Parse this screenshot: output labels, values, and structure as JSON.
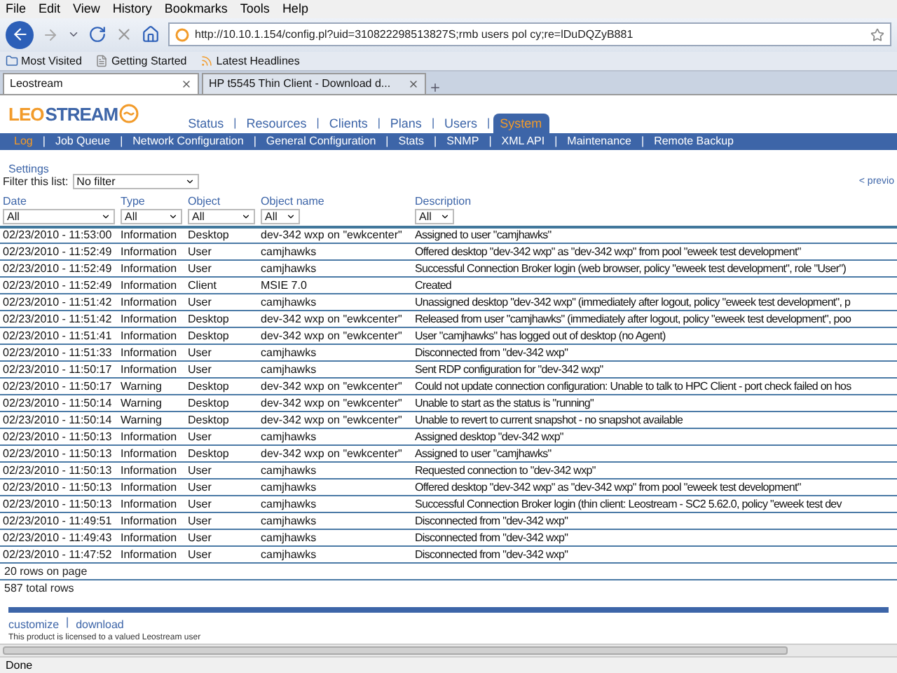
{
  "menu_bar": [
    "File",
    "Edit",
    "View",
    "History",
    "Bookmarks",
    "Tools",
    "Help"
  ],
  "toolbar": {
    "url": "http://10.10.1.154/config.pl?uid=310822298513827S;rmb users pol cy;re=lDuDQZyB881"
  },
  "bookmarks": [
    "Most Visited",
    "Getting Started",
    "Latest Headlines"
  ],
  "browser_tabs": [
    {
      "label": "Leostream",
      "selected": true
    },
    {
      "label": "HP t5545 Thin Client - Download d...",
      "selected": false
    }
  ],
  "app": {
    "logo": {
      "prefix": "LEO",
      "suffix": "STREAM"
    },
    "nav": [
      {
        "label": "Status",
        "selected": false
      },
      {
        "sep": "|",
        "label": "Resources",
        "selected": false
      },
      {
        "sep": "|",
        "label": "Clients",
        "selected": false
      },
      {
        "sep": "|",
        "label": "Plans",
        "selected": false
      },
      {
        "sep": "|",
        "label": "Users",
        "selected": false
      },
      {
        "sep": "|",
        "label": "System",
        "selected": true
      }
    ],
    "subnav": [
      {
        "label": "Log",
        "selected": true
      },
      {
        "sep": "|",
        "label": "Job Queue",
        "selected": false
      },
      {
        "sep": "|",
        "label": "Network Configuration",
        "selected": false
      },
      {
        "sep": "|",
        "label": "General Configuration",
        "selected": false
      },
      {
        "sep": "|",
        "label": "Stats",
        "selected": false
      },
      {
        "sep": "|",
        "label": "SNMP",
        "selected": false
      },
      {
        "sep": "|",
        "label": "XML API",
        "selected": false
      },
      {
        "sep": "|",
        "label": "Maintenance",
        "selected": false
      },
      {
        "sep": "|",
        "label": "Remote Backup",
        "selected": false
      }
    ],
    "settings_link": "Settings",
    "filter": {
      "label": "Filter this list:",
      "value": "No filter"
    },
    "pager": "< previo",
    "table": {
      "columns": [
        {
          "label": "Date",
          "filter": "All"
        },
        {
          "label": "Type",
          "filter": "All"
        },
        {
          "label": "Object",
          "filter": "All"
        },
        {
          "label": "Object name",
          "filter": "All"
        },
        {
          "label": "Description",
          "filter": "All"
        }
      ],
      "rows": [
        [
          "02/23/2010 - 11:53:00",
          "Information",
          "Desktop",
          "dev-342 wxp on \"ewkcenter\"",
          "Assigned to user \"camjhawks\""
        ],
        [
          "02/23/2010 - 11:52:49",
          "Information",
          "User",
          "camjhawks",
          "Offered desktop \"dev-342 wxp\" as \"dev-342 wxp\" from pool \"eweek test development\""
        ],
        [
          "02/23/2010 - 11:52:49",
          "Information",
          "User",
          "camjhawks",
          "Successful Connection Broker login (web browser, policy \"eweek test development\", role \"User\")"
        ],
        [
          "02/23/2010 - 11:52:49",
          "Information",
          "Client",
          "MSIE 7.0",
          "Created"
        ],
        [
          "02/23/2010 - 11:51:42",
          "Information",
          "User",
          "camjhawks",
          "Unassigned desktop \"dev-342 wxp\" (immediately after logout, policy \"eweek test development\", p"
        ],
        [
          "02/23/2010 - 11:51:42",
          "Information",
          "Desktop",
          "dev-342 wxp on \"ewkcenter\"",
          "Released from user \"camjhawks\" (immediately after logout, policy \"eweek test development\", poo"
        ],
        [
          "02/23/2010 - 11:51:41",
          "Information",
          "Desktop",
          "dev-342 wxp on \"ewkcenter\"",
          "User \"camjhawks\" has logged out of desktop (no Agent)"
        ],
        [
          "02/23/2010 - 11:51:33",
          "Information",
          "User",
          "camjhawks",
          "Disconnected from \"dev-342 wxp\""
        ],
        [
          "02/23/2010 - 11:50:17",
          "Information",
          "User",
          "camjhawks",
          "Sent RDP configuration for \"dev-342 wxp\""
        ],
        [
          "02/23/2010 - 11:50:17",
          "Warning",
          "Desktop",
          "dev-342 wxp on \"ewkcenter\"",
          "Could not update connection configuration: Unable to talk to HPC Client - port check failed on hos"
        ],
        [
          "02/23/2010 - 11:50:14",
          "Warning",
          "Desktop",
          "dev-342 wxp on \"ewkcenter\"",
          "Unable to start as the status is \"running\""
        ],
        [
          "02/23/2010 - 11:50:14",
          "Warning",
          "Desktop",
          "dev-342 wxp on \"ewkcenter\"",
          "Unable to revert to current snapshot - no snapshot available"
        ],
        [
          "02/23/2010 - 11:50:13",
          "Information",
          "User",
          "camjhawks",
          "Assigned desktop \"dev-342 wxp\""
        ],
        [
          "02/23/2010 - 11:50:13",
          "Information",
          "Desktop",
          "dev-342 wxp on \"ewkcenter\"",
          "Assigned to user \"camjhawks\""
        ],
        [
          "02/23/2010 - 11:50:13",
          "Information",
          "User",
          "camjhawks",
          "Requested connection to \"dev-342 wxp\""
        ],
        [
          "02/23/2010 - 11:50:13",
          "Information",
          "User",
          "camjhawks",
          "Offered desktop \"dev-342 wxp\" as \"dev-342 wxp\" from pool \"eweek test development\""
        ],
        [
          "02/23/2010 - 11:50:13",
          "Information",
          "User",
          "camjhawks",
          "Successful Connection Broker login (thin client: Leostream - SC2 5.62.0, policy \"eweek test dev"
        ],
        [
          "02/23/2010 - 11:49:51",
          "Information",
          "User",
          "camjhawks",
          "Disconnected from \"dev-342 wxp\""
        ],
        [
          "02/23/2010 - 11:49:43",
          "Information",
          "User",
          "camjhawks",
          "Disconnected from \"dev-342 wxp\""
        ],
        [
          "02/23/2010 - 11:47:52",
          "Information",
          "User",
          "camjhawks",
          "Disconnected from \"dev-342 wxp\""
        ]
      ]
    },
    "rows_on_page": "20 rows on page",
    "total_rows": "587 total rows",
    "footer_links": [
      {
        "label": "customize"
      },
      {
        "sep": "|",
        "label": "download"
      }
    ],
    "license_note": "This product is licensed to a valued Leostream user"
  },
  "status_bar": "Done"
}
